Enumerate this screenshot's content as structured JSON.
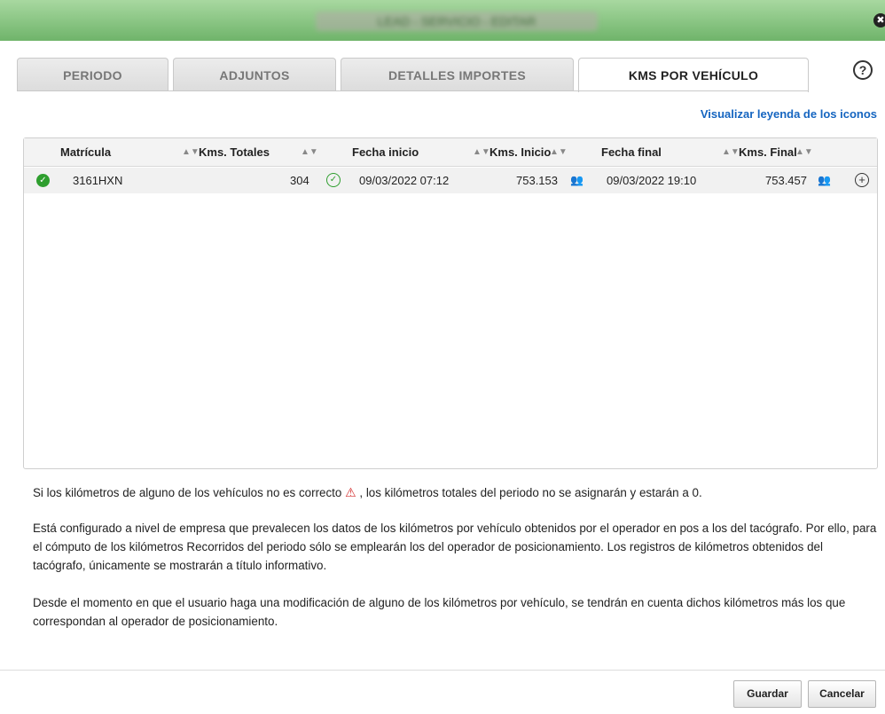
{
  "window": {
    "title": "LEAD - SERVICIO - EDITAR",
    "close_glyph": "✖"
  },
  "tabs": [
    {
      "label": "PERIODO",
      "active": false
    },
    {
      "label": "ADJUNTOS",
      "active": false
    },
    {
      "label": "DETALLES IMPORTES",
      "active": false
    },
    {
      "label": "KMS POR VEHÍCULO",
      "active": true
    }
  ],
  "help_glyph": "?",
  "legend_link": "Visualizar leyenda de los iconos",
  "table": {
    "columns": [
      "Matrícula",
      "Kms. Totales",
      "Fecha inicio",
      "Kms. Inicio",
      "Fecha final",
      "Kms. Final"
    ],
    "rows": [
      {
        "matricula": "3161HXN",
        "kms_totales": "304",
        "fecha_inicio": "09/03/2022 07:12",
        "kms_inicio": "753.153",
        "fecha_final": "09/03/2022 19:10",
        "kms_final": "753.457"
      }
    ]
  },
  "icons": {
    "status_ok": "✓",
    "check": "✓",
    "operator": "👥",
    "plus": "+",
    "warning": "⚠",
    "sort": "▲▼"
  },
  "info": {
    "warning_pre": "Si los kilómetros de alguno de los vehículos no es correcto",
    "warning_post": ", los kilómetros totales del periodo no se asignarán y estarán a 0.",
    "paragraph2": "Está configurado a nivel de empresa que prevalecen los datos de los kilómetros por vehículo obtenidos por el operador en pos a los del tacógrafo. Por ello, para el cómputo de los kilómetros Recorridos del periodo sólo se emplearán los del operador de posicionamiento. Los registros de kilómetros obtenidos del tacógrafo, únicamente se mostrarán a título informativo.",
    "paragraph3": "Desde el momento en que el usuario haga una modificación de alguno de los kilómetros por vehículo, se tendrán en cuenta dichos kilómetros más los que correspondan al operador de posicionamiento."
  },
  "buttons": {
    "save": "Guardar",
    "cancel": "Cancelar"
  },
  "colors": {
    "titlebar": "#6fb46a",
    "link": "#1565c0",
    "ok_green": "#2e9e2e",
    "warning_red": "#d32f2f"
  }
}
